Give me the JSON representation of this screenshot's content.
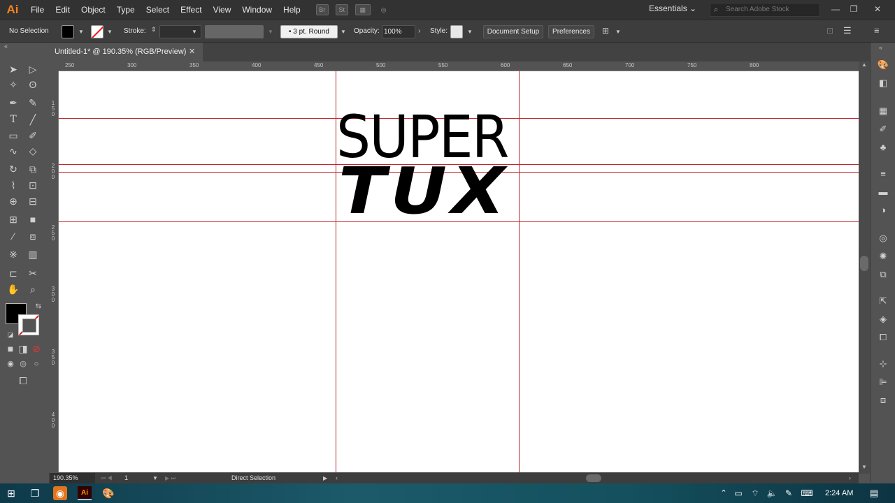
{
  "app": {
    "logo": "Ai",
    "window_title": "Untitled-1* @ 190.35% (RGB/Preview)"
  },
  "menu": [
    "File",
    "Edit",
    "Object",
    "Type",
    "Select",
    "Effect",
    "View",
    "Window",
    "Help"
  ],
  "menubar_icons": {
    "br": "Br",
    "st": "St"
  },
  "workspace": "Essentials",
  "search": {
    "placeholder": "Search Adobe Stock"
  },
  "control": {
    "selection": "No Selection",
    "stroke_label": "Stroke:",
    "brush": "3 pt. Round",
    "opacity_label": "Opacity:",
    "opacity": "100%",
    "style_label": "Style:",
    "doc_setup": "Document Setup",
    "preferences": "Preferences"
  },
  "ruler_h": [
    "200",
    "250",
    "300",
    "350",
    "400",
    "450",
    "500",
    "550",
    "600",
    "650",
    "700",
    "750",
    "800"
  ],
  "ruler_v": [
    "150",
    "200",
    "250",
    "300",
    "350",
    "400"
  ],
  "canvas": {
    "line1": "SUPER",
    "line2": "TUX"
  },
  "status": {
    "zoom": "190.35%",
    "artboard": "1",
    "tool": "Direct Selection"
  },
  "taskbar": {
    "time": "2:24 AM"
  },
  "colors": {
    "guide": "#c0272d",
    "accent": "#f58220"
  }
}
